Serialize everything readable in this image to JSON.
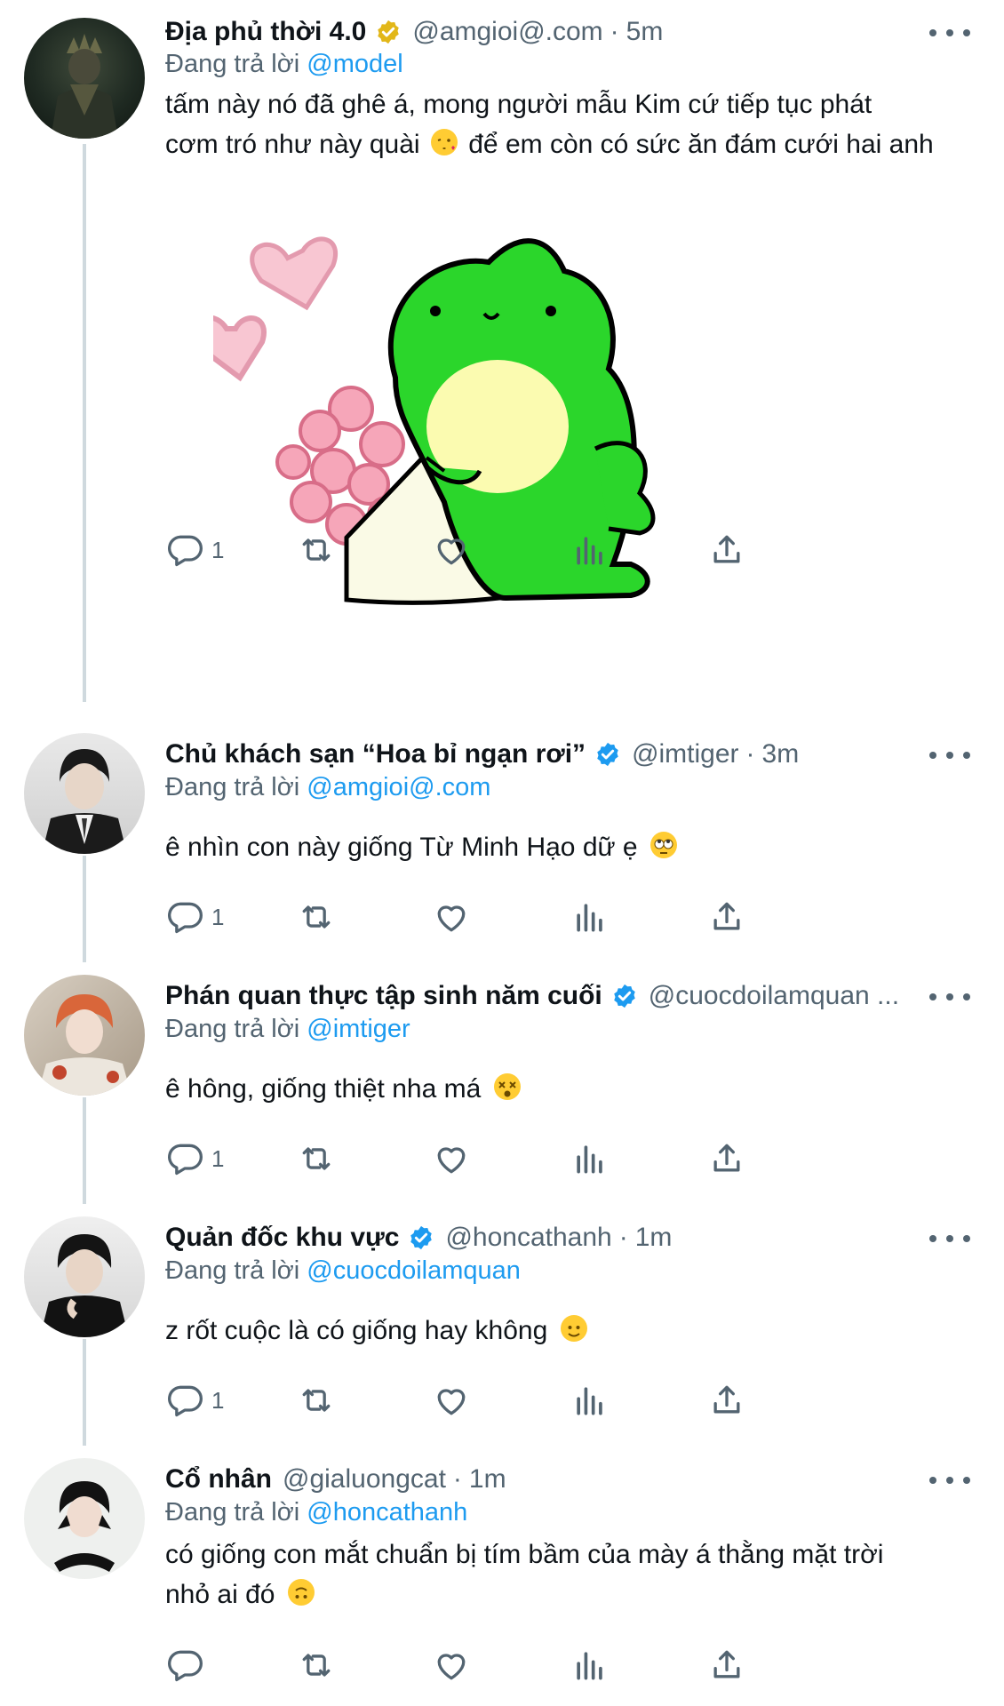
{
  "colors": {
    "link": "#1d9bf0",
    "muted": "#536471",
    "gold_badge": "#e2b719",
    "blue_badge": "#1d9bf0"
  },
  "tweets": [
    {
      "name": "Địa phủ thời 4.0",
      "badge": "gold-verified",
      "handle": "@amgioi@.com",
      "time": "5m",
      "replying_prefix": "Đang trả lời",
      "replying_to": "@model",
      "text_lines": [
        "tấm này nó đã ghê á, mong người mẫu Kim cứ tiếp tục phát",
        "cơm tró như này quài",
        "để em còn có sức ăn đám cưới hai anh"
      ],
      "emoji": "kissing-face",
      "media": "frog-with-flowers-sticker",
      "reply_count": "1"
    },
    {
      "name": "Chủ khách sạn “Hoa bỉ ngạn rơi”",
      "badge": "blue-verified",
      "handle": "@imtiger",
      "time": "3m",
      "replying_prefix": "Đang trả lời",
      "replying_to": "@amgioi@.com",
      "text": "ê nhìn con này giống Từ Minh Hạo dữ ẹ",
      "emoji": "rolling-eyes-face",
      "reply_count": "1"
    },
    {
      "name": "Phán quan thực tập sinh năm cuối",
      "badge": "blue-verified",
      "handle": "@cuocdoilamquan ...",
      "time": "",
      "replying_prefix": "Đang trả lời",
      "replying_to": "@imtiger",
      "text": "ê hông, giống thiệt nha má",
      "emoji": "dizzy-face",
      "reply_count": "1"
    },
    {
      "name": "Quản đốc khu vực",
      "badge": "blue-verified",
      "handle": "@honcathanh",
      "time": "1m",
      "replying_prefix": "Đang trả lời",
      "replying_to": "@cuocdoilamquan",
      "text": "z rốt cuộc là có giống hay không",
      "emoji": "slightly-smiling-face",
      "reply_count": "1"
    },
    {
      "name": "Cổ nhân",
      "badge": "",
      "handle": "@gialuongcat",
      "time": "1m",
      "replying_prefix": "Đang trả lời",
      "replying_to": "@honcathanh",
      "text_lines": [
        "có giống con mắt chuẩn bị tím bầm của mày á thằng mặt trời",
        "nhỏ ai đó"
      ],
      "emoji": "upside-down-face",
      "reply_count": ""
    }
  ],
  "action_icons": [
    "reply-icon",
    "retweet-icon",
    "like-icon",
    "views-icon",
    "share-icon"
  ]
}
